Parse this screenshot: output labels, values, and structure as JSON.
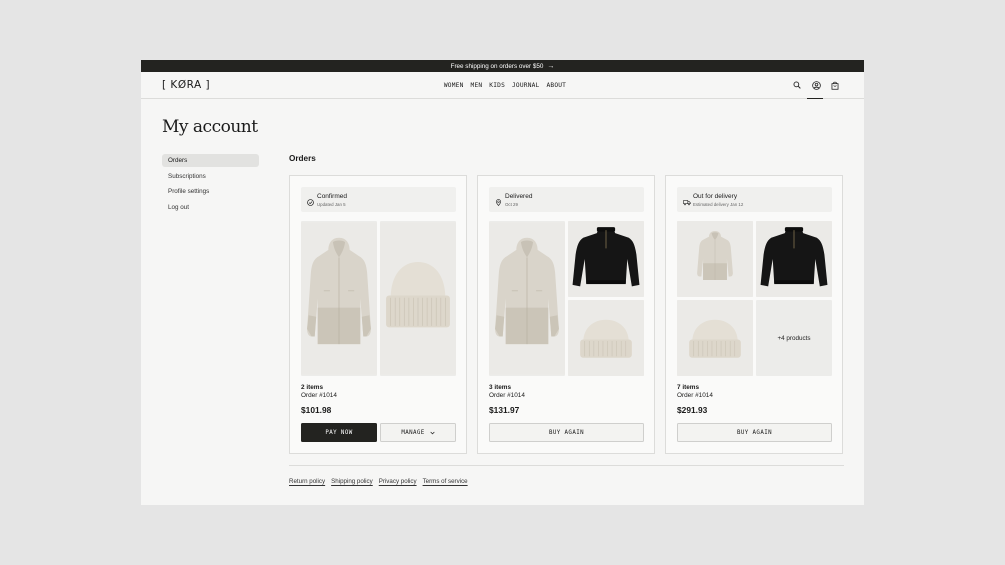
{
  "announcement": {
    "text": "Free shipping on orders over $50",
    "arrow": "→"
  },
  "header": {
    "logo": "[ KØRA ]",
    "nav": [
      "WOMEN",
      "MEN",
      "KIDS",
      "JOURNAL",
      "ABOUT"
    ],
    "icons": [
      "search-icon",
      "account-icon",
      "bag-icon"
    ]
  },
  "page_title": "My account",
  "sidebar": {
    "items": [
      {
        "label": "Orders",
        "active": true
      },
      {
        "label": "Subscriptions",
        "active": false
      },
      {
        "label": "Profile settings",
        "active": false
      },
      {
        "label": "Log out",
        "active": false
      }
    ]
  },
  "orders": {
    "title": "Orders",
    "cards": [
      {
        "status": "Confirmed",
        "status_sub": "Updated Jan 5",
        "status_icon": "check-circle-icon",
        "products": [
          "jacket",
          "beanie"
        ],
        "items": "2 items",
        "order_no": "Order #1014",
        "price": "$101.98",
        "primary_button": "PAY NOW",
        "secondary_button": "MANAGE"
      },
      {
        "status": "Delivered",
        "status_sub": "Oct 29",
        "status_icon": "location-pin-icon",
        "products": [
          "jacket",
          "sweater",
          "beanie"
        ],
        "items": "3 items",
        "order_no": "Order #1014",
        "price": "$131.97",
        "button": "BUY AGAIN"
      },
      {
        "status": "Out for delivery",
        "status_sub": "Estimated delivery Jan 12",
        "status_icon": "truck-icon",
        "products": [
          "jacket",
          "sweater",
          "beanie"
        ],
        "more_products": "+4 products",
        "items": "7 items",
        "order_no": "Order #1014",
        "price": "$291.93",
        "button": "BUY AGAIN"
      }
    ]
  },
  "footer": {
    "links": [
      "Return policy",
      "Shipping policy",
      "Privacy policy",
      "Terms of service"
    ]
  },
  "colors": {
    "dark": "#232320",
    "page": "#f6f6f5",
    "backdrop": "#e5e5e5"
  }
}
